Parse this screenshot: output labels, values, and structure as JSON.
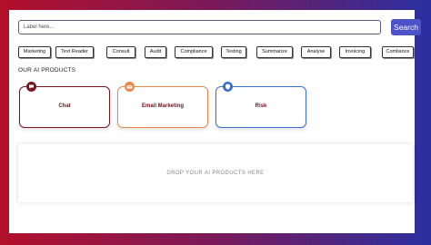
{
  "search": {
    "placeholder": "Label here...",
    "button_label": "Search"
  },
  "tags": [
    "Marketing",
    "Text Reader",
    "Consult",
    "Audit",
    "Compliance",
    "Testing",
    "Summarize",
    "Analyse",
    "Invoicing",
    "Comliance"
  ],
  "section_title": "OUR AI PRODUCTS",
  "products": [
    {
      "label": "Chat",
      "icon": "chat-icon",
      "border_color": "#7a1520",
      "badge_color": "#7a1520"
    },
    {
      "label": "Email Marketing",
      "icon": "email-icon",
      "border_color": "#e8894a",
      "badge_color": "#e8894a"
    },
    {
      "label": "Risk",
      "icon": "shield-icon",
      "border_color": "#3b6fcf",
      "badge_color": "#3b6fcf"
    }
  ],
  "drop_zone": {
    "text": "DROP YOUR AI PRODUCTS HERE"
  },
  "colors": {
    "accent": "#4e52c9",
    "gradient_left": "#b3102a",
    "gradient_right": "#2a2fa0"
  }
}
